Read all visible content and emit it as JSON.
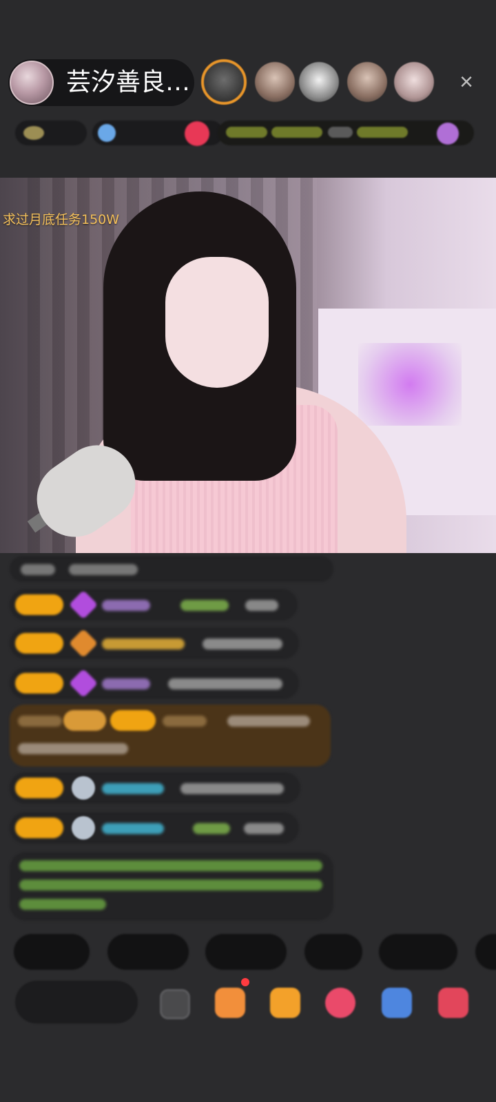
{
  "header": {
    "host_name": "芸汐善良…",
    "close_label": "×"
  },
  "video": {
    "goal_text": "求过月底任务150W"
  },
  "colors": {
    "background": "#2b2b2d",
    "badge": "#f0a412",
    "goal_text": "#f4c05a",
    "viewer_ring": "#e9962a"
  },
  "icons": {
    "close": "close-icon",
    "gift": "gift-icon",
    "emoji": "emoji-icon",
    "more": "more-icon"
  }
}
